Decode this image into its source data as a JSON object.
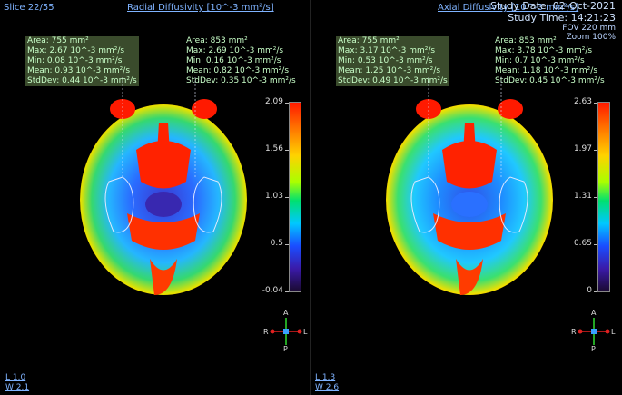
{
  "slice": "Slice 22/55",
  "study": {
    "date": "Study Date: 02-Oct-2021",
    "time": "Study Time: 14:21:23",
    "fov": "FOV 220 mm",
    "zoom": "Zoom 100%"
  },
  "panes": [
    {
      "title": "Radial Diffusivity [10^-3 mm²/s]",
      "left_roi": {
        "area": "Area: 755 mm²",
        "max": "Max: 2.67 10^-3 mm²/s",
        "min": "Min: 0.08 10^-3 mm²/s",
        "mean": "Mean: 0.93 10^-3 mm²/s",
        "stddev": "StdDev: 0.44 10^-3 mm²/s"
      },
      "right_roi": {
        "area": "Area: 853 mm²",
        "max": "Max: 2.69 10^-3 mm²/s",
        "min": "Min: 0.16 10^-3 mm²/s",
        "mean": "Mean: 0.82 10^-3 mm²/s",
        "stddev": "StdDev: 0.35 10^-3 mm²/s"
      },
      "colorbar_ticks": [
        "2.09",
        "1.56",
        "1.03",
        "0.5",
        "-0.04"
      ],
      "level": "L 1.0",
      "window": "W 2.1"
    },
    {
      "title": "Axial Diffusivity [10^-3 mm²/s]",
      "left_roi": {
        "area": "Area: 755 mm²",
        "max": "Max: 3.17 10^-3 mm²/s",
        "min": "Min: 0.53 10^-3 mm²/s",
        "mean": "Mean: 1.25 10^-3 mm²/s",
        "stddev": "StdDev: 0.49 10^-3 mm²/s"
      },
      "right_roi": {
        "area": "Area: 853 mm²",
        "max": "Max: 3.78 10^-3 mm²/s",
        "min": "Min: 0.7 10^-3 mm²/s",
        "mean": "Mean: 1.18 10^-3 mm²/s",
        "stddev": "StdDev: 0.45 10^-3 mm²/s"
      },
      "colorbar_ticks": [
        "2.63",
        "1.97",
        "1.31",
        "0.65",
        "0"
      ],
      "level": "L 1.3",
      "window": "W 2.6"
    }
  ],
  "orientation": {
    "anterior": "A",
    "posterior": "P",
    "right": "R",
    "left": "L"
  },
  "colors": {
    "link": "#7fb3ff",
    "stat_text": "#c8ffc8",
    "stat_bg": "#3a4b2c",
    "roi_outline": "#dfe8ff"
  },
  "icons": {
    "orientation": "orientation-cube-icon"
  }
}
